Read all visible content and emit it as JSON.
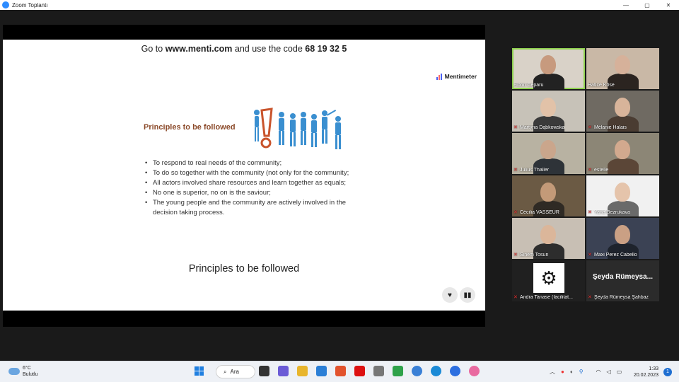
{
  "window": {
    "title": "Zoom Toplantı",
    "controls": [
      "—",
      "▢",
      "✕"
    ]
  },
  "slide": {
    "code_prefix": "Go to ",
    "code_site": "www.menti.com",
    "code_middle": " and use the code ",
    "code_value": "68 19 32 5",
    "brand": "Mentimeter",
    "heading": "Principles to be followed",
    "bullets": [
      "To respond to real needs of the community;",
      "To do so together with the community (not only for the community;",
      "All actors involved share resources and learn together as equals;",
      "No one is superior, no on is the saviour;",
      "The young people and the community are actively involved in the decision taking process."
    ],
    "subtitle": "Principles to be followed",
    "heart_icon": "heart-icon",
    "comment_icon": "comment-icon"
  },
  "participants": [
    {
      "name": "Florin Ceparu",
      "muted": false,
      "active": true,
      "bg": "#d9d2c8",
      "skin": "#c79a7e",
      "shirt": "#222222"
    },
    {
      "name": "Hatice Köse",
      "muted": false,
      "active": false,
      "bg": "#c9b8a6",
      "skin": "#d6b19a",
      "shirt": "#2b2420"
    },
    {
      "name": "Martyna Dąbkowska",
      "muted": true,
      "active": false,
      "bg": "#c7c2b8",
      "skin": "#e2c2a8",
      "shirt": "#3a3a3a"
    },
    {
      "name": "Mélanie Halais",
      "muted": true,
      "active": false,
      "bg": "#6f6a62",
      "skin": "#d8b49a",
      "shirt": "#4a3c32"
    },
    {
      "name": "Julius Thaller",
      "muted": true,
      "active": false,
      "bg": "#b8b2a2",
      "skin": "#caa68c",
      "shirt": "#2e3338"
    },
    {
      "name": "estelle",
      "muted": true,
      "active": false,
      "bg": "#8c8676",
      "skin": "#d2a98e",
      "shirt": "#5b4637"
    },
    {
      "name": "Cécilia VASSEUR",
      "muted": true,
      "active": false,
      "bg": "#6b5a44",
      "skin": "#c39a78",
      "shirt": "#2f2a24"
    },
    {
      "name": "Yana Bezrukava",
      "muted": true,
      "active": false,
      "bg": "#f1f1f1",
      "skin": "#e5c4ab",
      "shirt": "#6a6a6a"
    },
    {
      "name": "Sinem Tosun",
      "muted": true,
      "active": false,
      "bg": "#c8bfb4",
      "skin": "#dbb69a",
      "shirt": "#2d2d2d"
    },
    {
      "name": "Maxi Perez Cabello",
      "muted": true,
      "active": false,
      "bg": "#3b4254",
      "skin": "#caa084",
      "shirt": "#1e232c"
    },
    {
      "name": "Andra Tanase (facilitat...",
      "muted": true,
      "active": false,
      "bg": "#202020",
      "skin": "",
      "shirt": ""
    },
    {
      "name": "Şeyda Rümeysa Şahbaz",
      "muted": true,
      "active": false,
      "bg": "#2b2b2b",
      "skin": "",
      "shirt": "",
      "bigname": "Şeyda Rümeysa..."
    }
  ],
  "taskbar": {
    "temp": "6°C",
    "weather": "Bulutlu",
    "search": "Ara",
    "time": "1:33",
    "date": "20.02.2023",
    "notifications": "1",
    "app_colors": [
      "#333333",
      "#6b5bd6",
      "#e8b52c",
      "#2b7fd6",
      "#e2532d",
      "#d11",
      "#777",
      "#2fa24a",
      "#3a80d6",
      "#1b8ad6",
      "#2d6fe0",
      "#e96aa0"
    ]
  }
}
